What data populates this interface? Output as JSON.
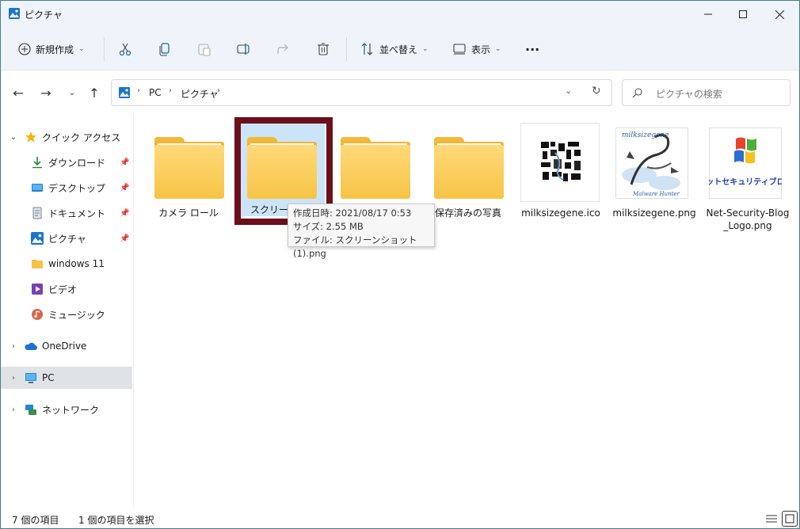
{
  "window": {
    "title": "ピクチャ"
  },
  "toolbar": {
    "new_label": "新規作成",
    "sort_label": "並べ替え",
    "view_label": "表示",
    "more_label": "···"
  },
  "address": {
    "crumbs": [
      "PC",
      "ピクチャ"
    ],
    "search_placeholder": "ピクチャの検索"
  },
  "sidebar": {
    "quick_access": "クイック アクセス",
    "items": [
      {
        "label": "ダウンロード",
        "pinned": true
      },
      {
        "label": "デスクトップ",
        "pinned": true
      },
      {
        "label": "ドキュメント",
        "pinned": true
      },
      {
        "label": "ピクチャ",
        "pinned": true
      },
      {
        "label": "windows 11",
        "pinned": false
      },
      {
        "label": "ビデオ",
        "pinned": false
      },
      {
        "label": "ミュージック",
        "pinned": false
      }
    ],
    "onedrive": "OneDrive",
    "pc": "PC",
    "network": "ネットワーク"
  },
  "files": [
    {
      "name": "カメラ ロール",
      "type": "folder"
    },
    {
      "name": "スクリーン",
      "type": "folder",
      "selected": true
    },
    {
      "name": "",
      "type": "folder"
    },
    {
      "name": "保存済みの写真",
      "type": "folder"
    },
    {
      "name": "milksizegene.ico",
      "type": "image"
    },
    {
      "name": "milksizegene.png",
      "type": "image"
    },
    {
      "name": "Net-Security-Blog_Logo.png",
      "type": "image"
    }
  ],
  "tooltip": {
    "line1": "作成日時: 2021/08/17 0:53",
    "line2": "サイズ: 2.55 MB",
    "line3": "ファイル: スクリーンショット (1).png"
  },
  "status": {
    "count": "7 個の項目",
    "selected": "1 個の項目を選択"
  },
  "thumb_labels": {
    "milk": "milksizegene",
    "milk_sub": "Malware Hunter",
    "netsec": "ネットセキュリティブログ"
  },
  "colors": {
    "accent": "#0067c0",
    "folder": "#f6c445",
    "highlight": "#6b0f1a",
    "selection": "#cce4f7"
  }
}
